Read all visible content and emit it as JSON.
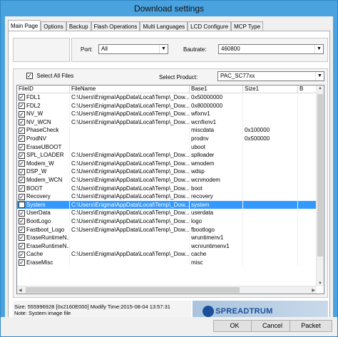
{
  "window": {
    "title": "Download settings"
  },
  "tabs": [
    "Main Page",
    "Options",
    "Backup",
    "Flash Operations",
    "Multi Languages",
    "LCD Configure",
    "MCP Type"
  ],
  "port": {
    "label": "Port:",
    "value": "All"
  },
  "baudrate": {
    "label": "Bautrate:",
    "value": "460800"
  },
  "select_all": {
    "label": "Select All Files",
    "checked": true
  },
  "product": {
    "label": "Select Product:",
    "value": "PAC_SC77xx"
  },
  "table": {
    "columns": [
      "FileID",
      "FileName",
      "Base1",
      "Size1",
      "B"
    ],
    "rows": [
      {
        "id": "FDL1",
        "file": "C:\\Users\\Enigma\\AppData\\Local\\Temp\\_Dow...",
        "base": "0x50000000",
        "size": ""
      },
      {
        "id": "FDL2",
        "file": "C:\\Users\\Enigma\\AppData\\Local\\Temp\\_Dow...",
        "base": "0x80000000",
        "size": ""
      },
      {
        "id": "NV_W",
        "file": "C:\\Users\\Enigma\\AppData\\Local\\Temp\\_Dow...",
        "base": "wfixnv1",
        "size": ""
      },
      {
        "id": "NV_WCN",
        "file": "C:\\Users\\Enigma\\AppData\\Local\\Temp\\_Dow...",
        "base": "wcnfixnv1",
        "size": ""
      },
      {
        "id": "PhaseCheck",
        "file": "",
        "base": "miscdata",
        "size": "0x100000"
      },
      {
        "id": "ProdNV",
        "file": "",
        "base": "prodnv",
        "size": "0x500000"
      },
      {
        "id": "EraseUBOOT",
        "file": "",
        "base": "uboot",
        "size": ""
      },
      {
        "id": "SPL_LOADER",
        "file": "C:\\Users\\Enigma\\AppData\\Local\\Temp\\_Dow...",
        "base": "splloader",
        "size": ""
      },
      {
        "id": "Modem_W",
        "file": "C:\\Users\\Enigma\\AppData\\Local\\Temp\\_Dow...",
        "base": "wmodem",
        "size": ""
      },
      {
        "id": "DSP_W",
        "file": "C:\\Users\\Enigma\\AppData\\Local\\Temp\\_Dow...",
        "base": "wdsp",
        "size": ""
      },
      {
        "id": "Modem_WCN",
        "file": "C:\\Users\\Enigma\\AppData\\Local\\Temp\\_Dow...",
        "base": "wcnmodem",
        "size": ""
      },
      {
        "id": "BOOT",
        "file": "C:\\Users\\Enigma\\AppData\\Local\\Temp\\_Dow...",
        "base": "boot",
        "size": ""
      },
      {
        "id": "Recovery",
        "file": "C:\\Users\\Enigma\\AppData\\Local\\Temp\\_Dow...",
        "base": "recovery",
        "size": ""
      },
      {
        "id": "System",
        "file": "C:\\Users\\Enigma\\AppData\\Local\\Temp\\_Dow...",
        "base": "system",
        "size": "",
        "selected": true
      },
      {
        "id": "UserData",
        "file": "C:\\Users\\Enigma\\AppData\\Local\\Temp\\_Dow...",
        "base": "userdata",
        "size": ""
      },
      {
        "id": "BootLogo",
        "file": "C:\\Users\\Enigma\\AppData\\Local\\Temp\\_Dow...",
        "base": "logo",
        "size": ""
      },
      {
        "id": "Fastboot_Logo",
        "file": "C:\\Users\\Enigma\\AppData\\Local\\Temp\\_Dow...",
        "base": "fbootlogo",
        "size": ""
      },
      {
        "id": "EraseRuntimeN...",
        "file": "",
        "base": "wruntimenv1",
        "size": ""
      },
      {
        "id": "EraseRuntimeN...",
        "file": "",
        "base": "wcnruntimenv1",
        "size": ""
      },
      {
        "id": "Cache",
        "file": "C:\\Users\\Enigma\\AppData\\Local\\Temp\\_Dow...",
        "base": "cache",
        "size": ""
      },
      {
        "id": "EraseMisc",
        "file": "",
        "base": "misc",
        "size": ""
      }
    ]
  },
  "status": {
    "line1": "Size: 555996928 [0x2160E000] Modify Time:2015-08-04 13:57:31",
    "line2": "Note: System image file"
  },
  "logo": {
    "text": "SPREADTRUM"
  },
  "buttons": {
    "ok": "OK",
    "cancel": "Cancel",
    "packet": "Packet"
  }
}
